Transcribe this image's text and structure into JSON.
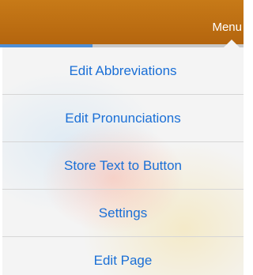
{
  "topbar": {
    "menu_label": "Menu",
    "background_color": "#b4650e",
    "progress_fraction": 0.38,
    "progress_color": "#4f8fd6"
  },
  "menu": {
    "accent_color": "#1a6fd6",
    "items": [
      {
        "label": "Edit Abbreviations"
      },
      {
        "label": "Edit Pronunciations"
      },
      {
        "label": "Store Text to Button"
      },
      {
        "label": "Settings"
      },
      {
        "label": "Edit Page"
      }
    ]
  }
}
